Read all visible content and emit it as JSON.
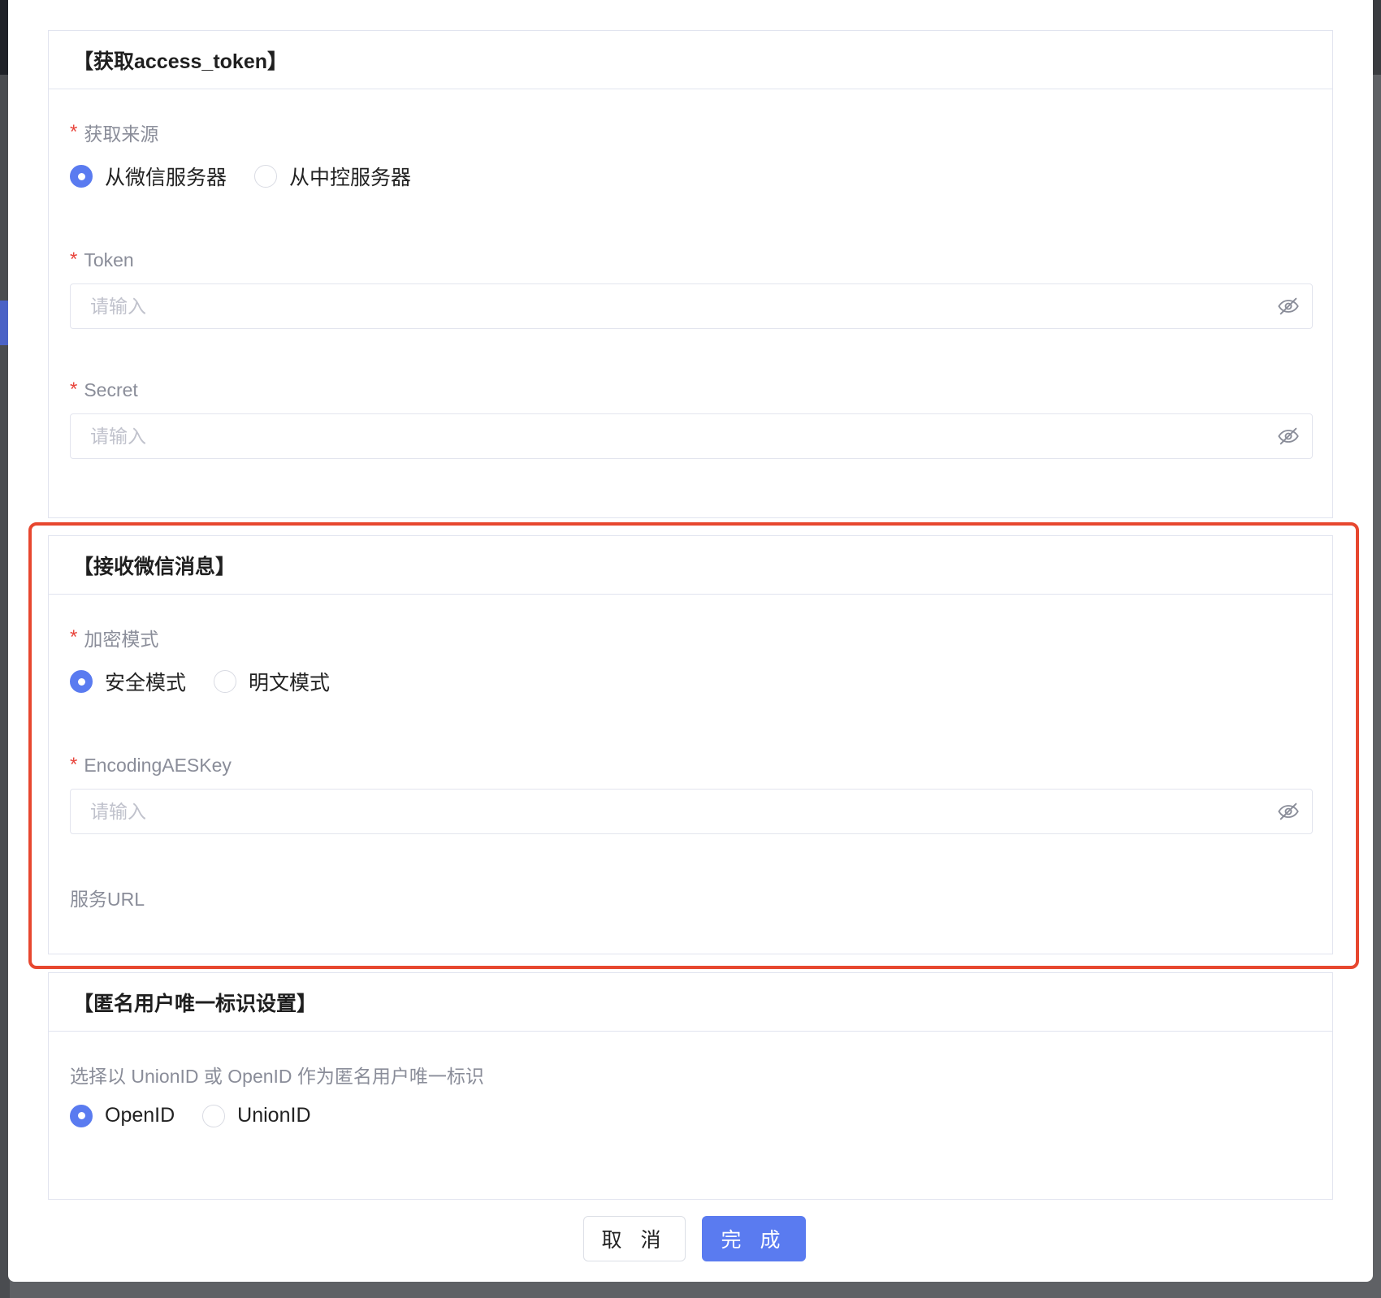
{
  "sections": {
    "access_token": {
      "title": "【获取access_token】",
      "source_label": "获取来源",
      "source_options": [
        "从微信服务器",
        "从中控服务器"
      ],
      "source_selected": "从微信服务器",
      "token_label": "Token",
      "token_placeholder": "请输入",
      "secret_label": "Secret",
      "secret_placeholder": "请输入"
    },
    "receive_msg": {
      "title": "【接收微信消息】",
      "mode_label": "加密模式",
      "mode_options": [
        "安全模式",
        "明文模式"
      ],
      "mode_selected": "安全模式",
      "aes_label": "EncodingAESKey",
      "aes_placeholder": "请输入",
      "url_label": "服务URL"
    },
    "anon_id": {
      "title": "【匿名用户唯一标识设置】",
      "desc": "选择以 UnionID 或 OpenID 作为匿名用户唯一标识",
      "id_options": [
        "OpenID",
        "UnionID"
      ],
      "id_selected": "OpenID"
    }
  },
  "required_mark": "*",
  "buttons": {
    "cancel": "取 消",
    "confirm": "完 成"
  },
  "icons": {
    "password_toggle": "eye-slash-icon"
  },
  "colors": {
    "primary": "#5a7bf0",
    "required": "#e8453c",
    "highlight_border": "#e7472f"
  }
}
